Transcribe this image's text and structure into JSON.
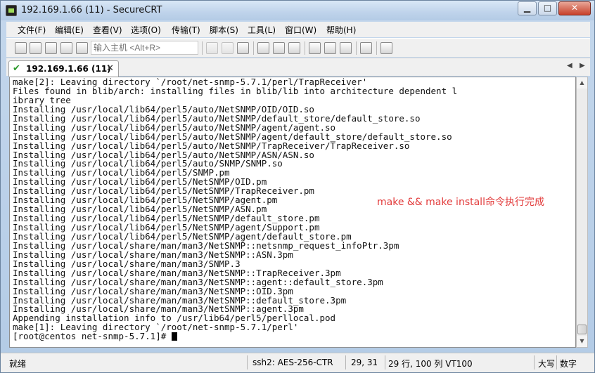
{
  "window": {
    "title": "192.169.1.66 (11) - SecureCRT",
    "buttons": {
      "minimize": "▁",
      "maximize": "□",
      "close": "✕"
    }
  },
  "menu": [
    "文件(F)",
    "编辑(E)",
    "查看(V)",
    "选项(O)",
    "传输(T)",
    "脚本(S)",
    "工具(L)",
    "窗口(W)",
    "帮助(H)"
  ],
  "toolbar": {
    "host_placeholder": "输入主机 <Alt+R>",
    "icons": [
      "connect-icon",
      "quick-connect-icon",
      "connect-tab-icon",
      "reconnect-icon",
      "disconnect-icon",
      "copy-icon",
      "paste-icon",
      "find-icon",
      "print-icon",
      "print-setup-icon",
      "print-screen-icon",
      "session-options-icon",
      "global-options-icon",
      "keymap-icon",
      "help-icon",
      "sftp-icon"
    ]
  },
  "tab": {
    "label": "192.169.1.66 (11)",
    "close": "✕",
    "prev": "◀",
    "next": "▶"
  },
  "terminal": {
    "lines": [
      "make[2]: Leaving directory `/root/net-snmp-5.7.1/perl/TrapReceiver'",
      "Files found in blib/arch: installing files in blib/lib into architecture dependent l",
      "ibrary tree",
      "Installing /usr/local/lib64/perl5/auto/NetSNMP/OID/OID.so",
      "Installing /usr/local/lib64/perl5/auto/NetSNMP/default_store/default_store.so",
      "Installing /usr/local/lib64/perl5/auto/NetSNMP/agent/agent.so",
      "Installing /usr/local/lib64/perl5/auto/NetSNMP/agent/default_store/default_store.so",
      "Installing /usr/local/lib64/perl5/auto/NetSNMP/TrapReceiver/TrapReceiver.so",
      "Installing /usr/local/lib64/perl5/auto/NetSNMP/ASN/ASN.so",
      "Installing /usr/local/lib64/perl5/auto/SNMP/SNMP.so",
      "Installing /usr/local/lib64/perl5/SNMP.pm",
      "Installing /usr/local/lib64/perl5/NetSNMP/OID.pm",
      "Installing /usr/local/lib64/perl5/NetSNMP/TrapReceiver.pm",
      "Installing /usr/local/lib64/perl5/NetSNMP/agent.pm",
      "Installing /usr/local/lib64/perl5/NetSNMP/ASN.pm",
      "Installing /usr/local/lib64/perl5/NetSNMP/default_store.pm",
      "Installing /usr/local/lib64/perl5/NetSNMP/agent/Support.pm",
      "Installing /usr/local/lib64/perl5/NetSNMP/agent/default_store.pm",
      "Installing /usr/local/share/man/man3/NetSNMP::netsnmp_request_infoPtr.3pm",
      "Installing /usr/local/share/man/man3/NetSNMP::ASN.3pm",
      "Installing /usr/local/share/man/man3/SNMP.3",
      "Installing /usr/local/share/man/man3/NetSNMP::TrapReceiver.3pm",
      "Installing /usr/local/share/man/man3/NetSNMP::agent::default_store.3pm",
      "Installing /usr/local/share/man/man3/NetSNMP::OID.3pm",
      "Installing /usr/local/share/man/man3/NetSNMP::default_store.3pm",
      "Installing /usr/local/share/man/man3/NetSNMP::agent.3pm",
      "Appending installation info to /usr/lib64/perl5/perllocal.pod",
      "make[1]: Leaving directory `/root/net-snmp-5.7.1/perl'",
      "[root@centos net-snmp-5.7.1]# "
    ],
    "annotation": "make && make install命令执行完成",
    "annotation_color": "#e23a3a"
  },
  "scrollbar": {
    "up": "▲",
    "down": "▼"
  },
  "status": {
    "state": "就绪",
    "cipher": "ssh2: AES-256-CTR",
    "position": "29,  31",
    "size": "29 行, 100 列 VT100",
    "caps": "大写",
    "num": "数字"
  }
}
